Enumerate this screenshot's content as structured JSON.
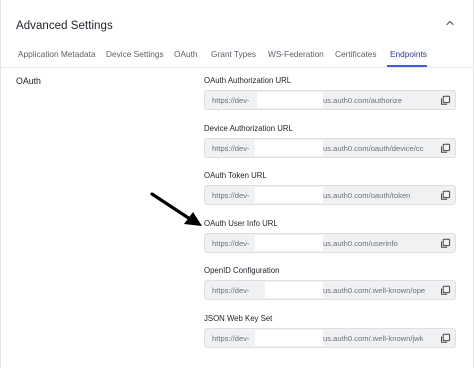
{
  "header": {
    "title": "Advanced Settings",
    "toggle_icon": "chevron-up-icon"
  },
  "tabs": [
    {
      "label": "Application Metadata",
      "active": false
    },
    {
      "label": "Device Settings",
      "active": false
    },
    {
      "label": "OAuth",
      "active": false
    },
    {
      "label": "Grant Types",
      "active": false
    },
    {
      "label": "WS-Federation",
      "active": false
    },
    {
      "label": "Certificates",
      "active": false
    },
    {
      "label": "Endpoints",
      "active": true
    }
  ],
  "section": {
    "label": "OAuth"
  },
  "fields": [
    {
      "label": "OAuth Authorization URL",
      "prefix": "https://dev-",
      "suffix": "us.auth0.com/authorize",
      "copy_icon": "copy-icon"
    },
    {
      "label": "Device Authorization URL",
      "prefix": "https://dev-",
      "suffix": "us.auth0.com/oauth/device/cc",
      "copy_icon": "copy-icon"
    },
    {
      "label": "OAuth Token URL",
      "prefix": "https://dev-",
      "suffix": "us.auth0.com/oauth/token",
      "copy_icon": "copy-icon"
    },
    {
      "label": "OAuth User Info URL",
      "prefix": "https://dev-",
      "suffix": "us.auth0.com/userinfo",
      "copy_icon": "copy-icon"
    },
    {
      "label": "OpenID Configuration",
      "prefix": "https://dev-",
      "suffix": "us.auth0.com/.well-known/ope",
      "copy_icon": "copy-icon"
    },
    {
      "label": "JSON Web Key Set",
      "prefix": "https://dev-",
      "suffix": "us.auth0.com/.well-known/jwk",
      "copy_icon": "copy-icon"
    }
  ],
  "colors": {
    "accent": "#3f59e4",
    "field_bg": "#f0f1f3",
    "text": "#1e212a",
    "muted": "#6c707a"
  }
}
